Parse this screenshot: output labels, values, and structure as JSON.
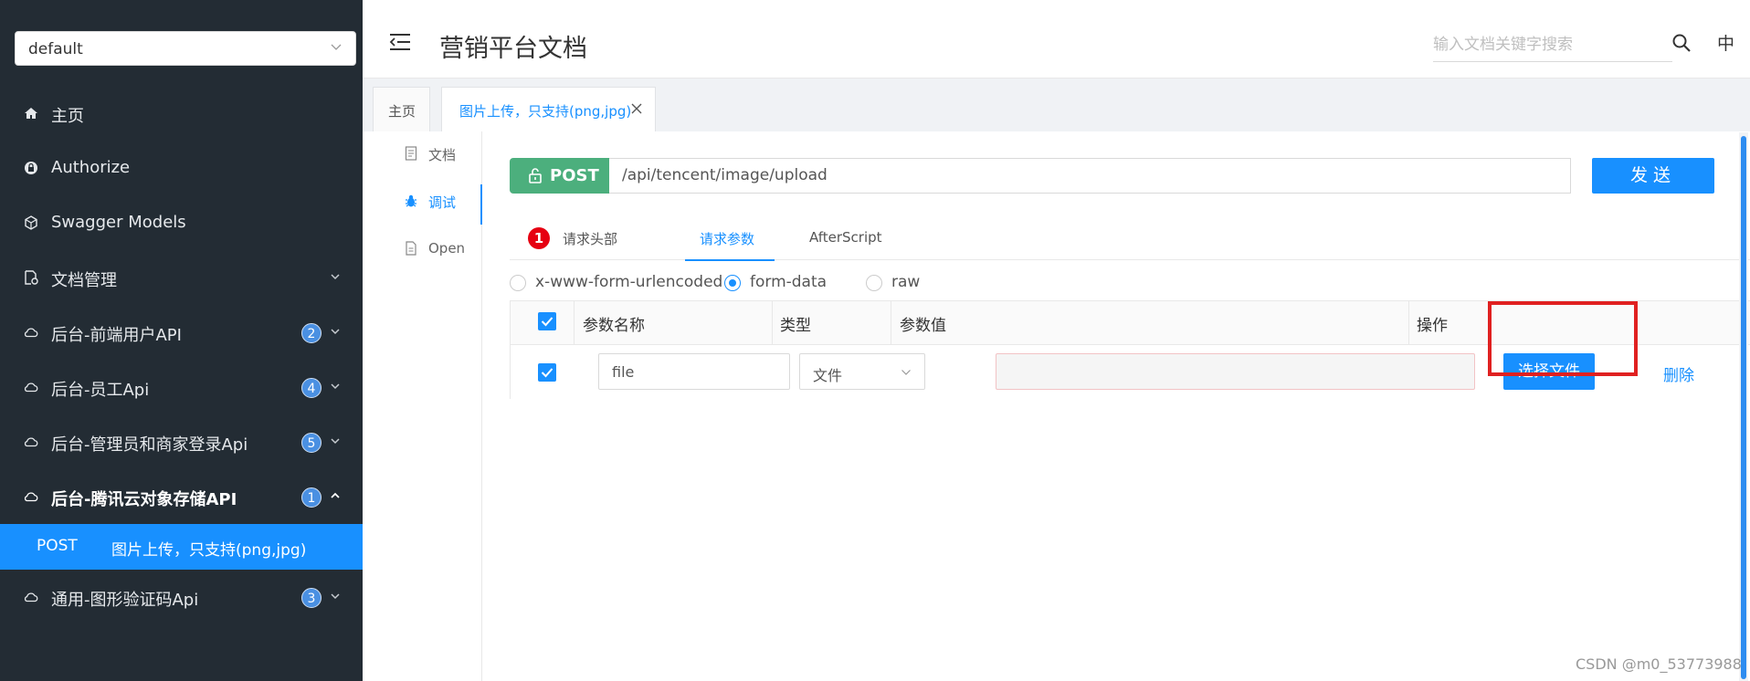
{
  "sidebar": {
    "group_value": "default",
    "items": [
      {
        "label": "主页",
        "icon": "home-icon",
        "badge": "",
        "arrow": ""
      },
      {
        "label": "Authorize",
        "icon": "lock-icon",
        "badge": "",
        "arrow": ""
      },
      {
        "label": "Swagger Models",
        "icon": "models-icon",
        "badge": "",
        "arrow": ""
      },
      {
        "label": "文档管理",
        "icon": "document-manage-icon",
        "badge": "",
        "arrow": "down"
      },
      {
        "label": "后台-前端用户API",
        "icon": "cloud-icon",
        "badge": "2",
        "arrow": "down"
      },
      {
        "label": "后台-员工Api",
        "icon": "cloud-icon",
        "badge": "4",
        "arrow": "down"
      },
      {
        "label": "后台-管理员和商家登录Api",
        "icon": "cloud-icon",
        "badge": "5",
        "arrow": "down"
      },
      {
        "label": "后台-腾讯云对象存储API",
        "icon": "cloud-icon",
        "badge": "1",
        "arrow": "up"
      },
      {
        "label": "通用-图形验证码Api",
        "icon": "cloud-icon",
        "badge": "3",
        "arrow": "down"
      }
    ],
    "sub_item": {
      "method": "POST",
      "title": "图片上传，只支持(png,jpg)"
    }
  },
  "header": {
    "title": "营销平台文档",
    "search_placeholder": "输入文档关键字搜索",
    "lang": "中"
  },
  "tabs": {
    "home": "主页",
    "active": "图片上传，只支持(png,jpg)"
  },
  "mini_nav": {
    "doc": "文档",
    "debug": "调试",
    "open": "Open"
  },
  "request": {
    "method": "POST",
    "url": "/api/tencent/image/upload",
    "send": "发送"
  },
  "param_tabs": {
    "headers_badge": "1",
    "headers": "请求头部",
    "params": "请求参数",
    "after": "AfterScript"
  },
  "body_types": {
    "urlencoded": "x-www-form-urlencoded",
    "form_data": "form-data",
    "raw": "raw",
    "selected": "form-data"
  },
  "table": {
    "headers": {
      "name": "参数名称",
      "type": "类型",
      "value": "参数值",
      "action": "操作"
    },
    "row": {
      "name": "file",
      "type": "文件",
      "file_button": "选择文件",
      "delete": "删除"
    }
  },
  "colors": {
    "sidebar_bg": "#232c34",
    "accent": "#1890ff",
    "post_green": "#4caf7d",
    "highlight_red": "#e02020"
  },
  "watermark": "CSDN @m0_53773988"
}
